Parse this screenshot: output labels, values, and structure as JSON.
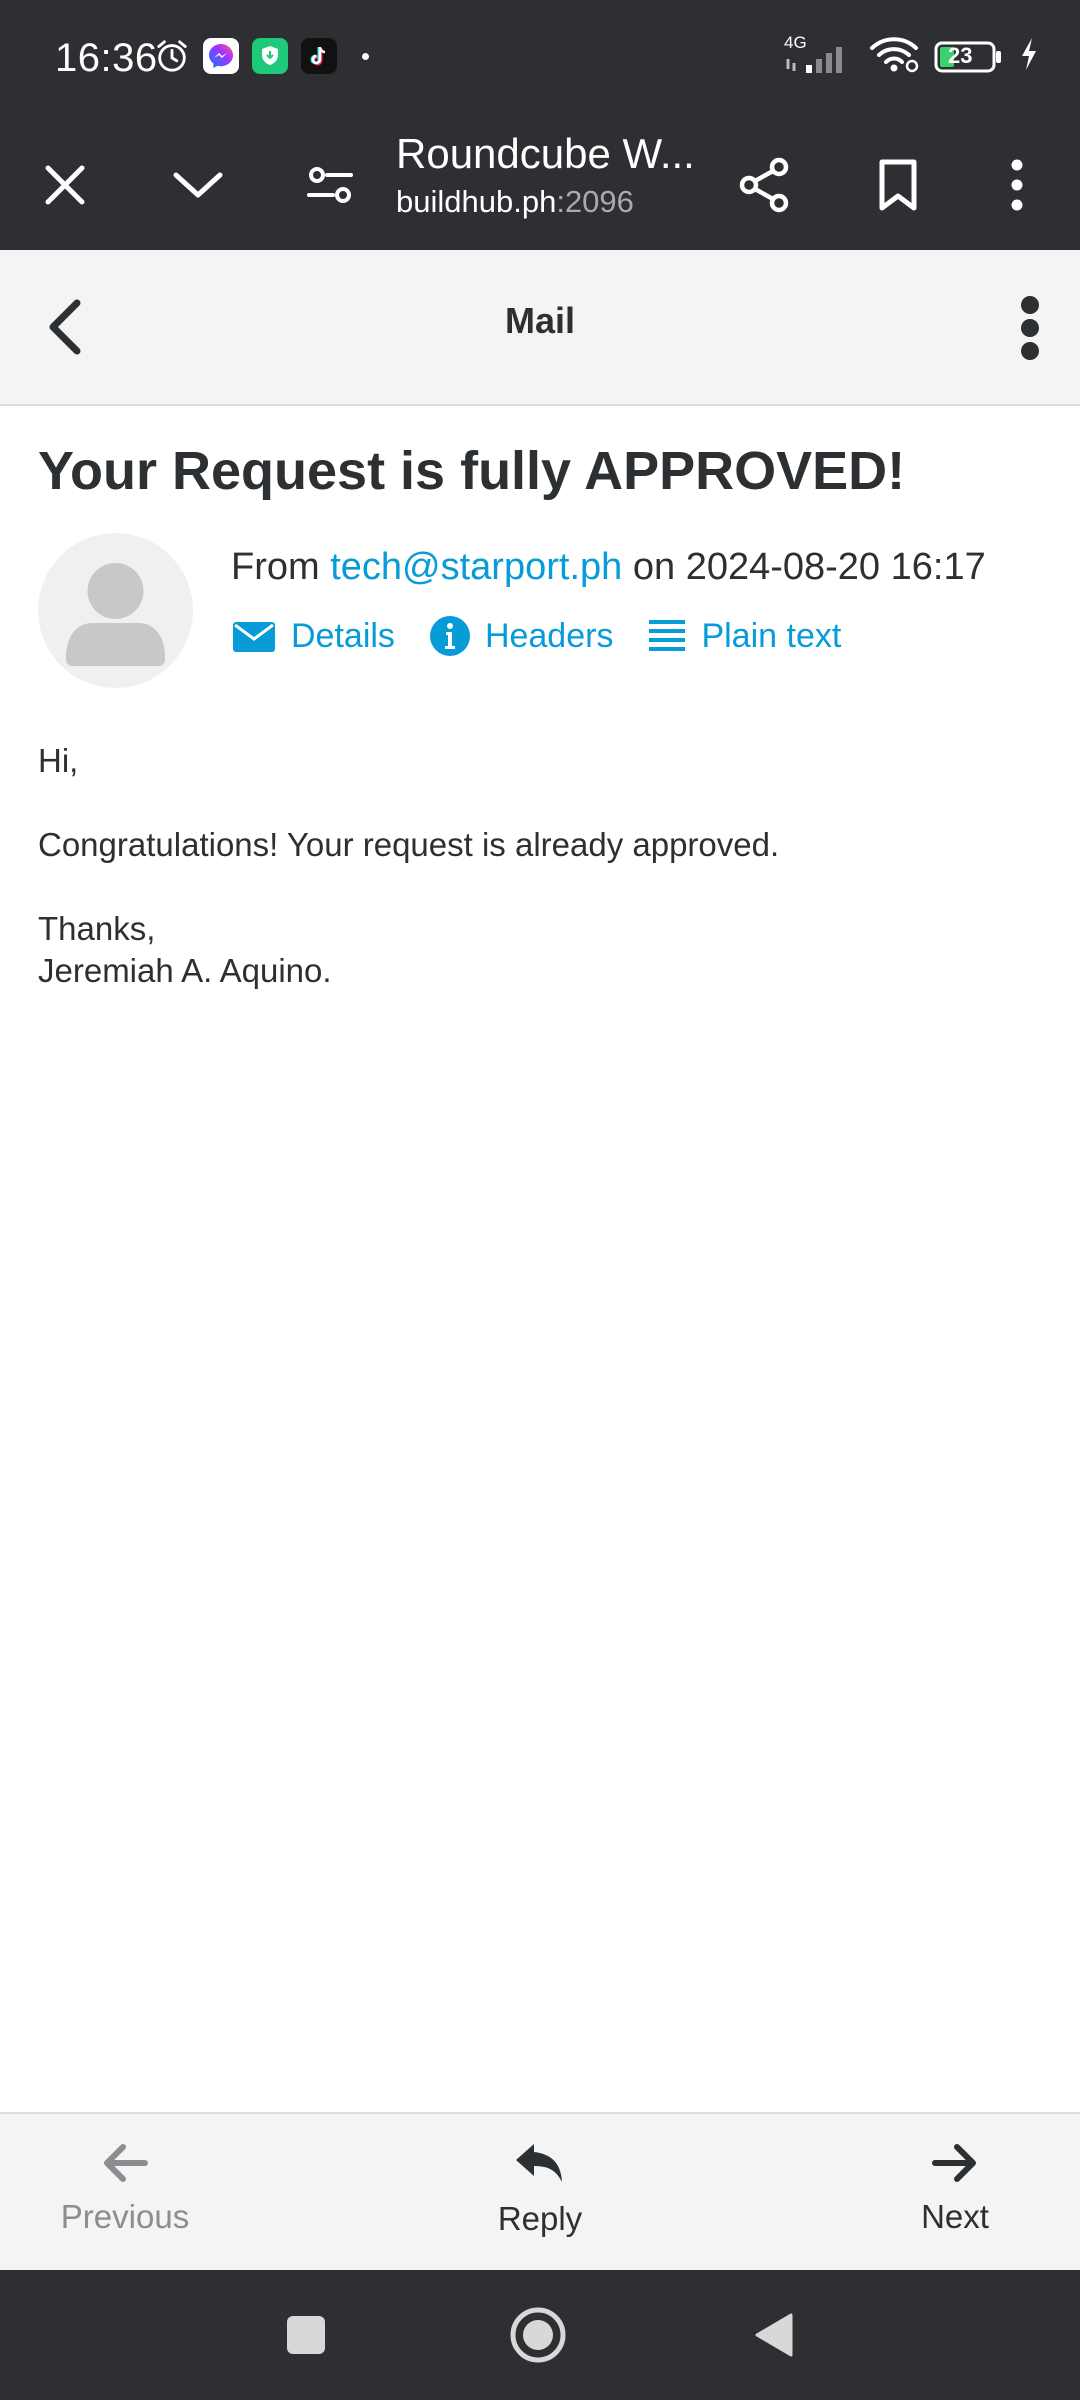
{
  "status_bar": {
    "time": "16:36",
    "network": "4G",
    "battery": "23",
    "icons": [
      "alarm-icon",
      "messenger-icon",
      "vpn-shield-icon",
      "tiktok-icon",
      "signal-icon",
      "wifi-icon",
      "battery-icon",
      "charging-icon"
    ]
  },
  "browser": {
    "title": "Roundcube W...",
    "url_host": "buildhub.ph",
    "url_port": ":2096",
    "icons": [
      "close-icon",
      "chevron-down-icon",
      "site-settings-icon",
      "share-icon",
      "bookmark-icon",
      "overflow-menu-icon"
    ]
  },
  "mail_header": {
    "title": "Mail",
    "icons": [
      "back-arrow-icon",
      "more-vertical-icon"
    ]
  },
  "message": {
    "subject": "Your Request is fully APPROVED!",
    "from_prefix": "From",
    "sender": "tech@starport.ph",
    "date_prefix": "on",
    "date": "2024-08-20 16:17",
    "links": {
      "details": "Details",
      "headers": "Headers",
      "plain_text": "Plain text"
    },
    "body": {
      "greeting": "Hi,",
      "line1": "Congratulations! Your request is already approved.",
      "closing": "Thanks,",
      "signature": "Jeremiah A. Aquino."
    }
  },
  "bottom_toolbar": {
    "previous": "Previous",
    "reply": "Reply",
    "next": "Next"
  },
  "colors": {
    "dark_bar": "#2e2f33",
    "link_blue": "#079bd8",
    "text": "#2c3033",
    "toolbar_bg": "#f4f4f4",
    "disabled": "#8b8d90"
  }
}
